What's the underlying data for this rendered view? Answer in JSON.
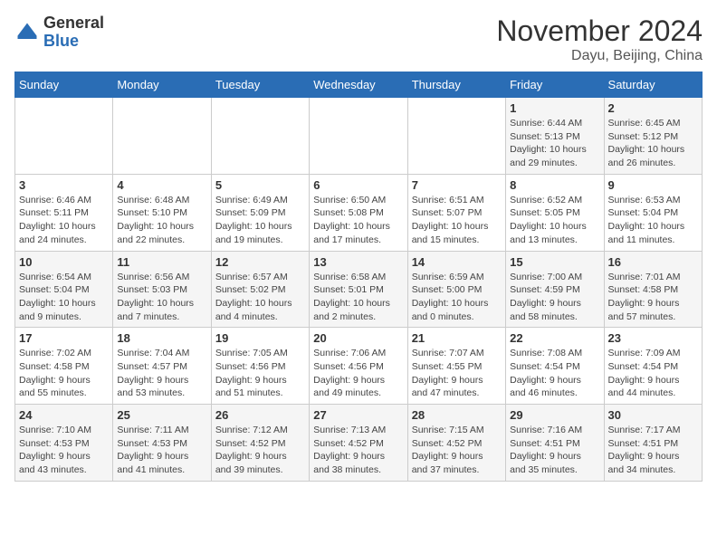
{
  "logo": {
    "general": "General",
    "blue": "Blue"
  },
  "header": {
    "month": "November 2024",
    "location": "Dayu, Beijing, China"
  },
  "weekdays": [
    "Sunday",
    "Monday",
    "Tuesday",
    "Wednesday",
    "Thursday",
    "Friday",
    "Saturday"
  ],
  "weeks": [
    [
      {
        "day": "",
        "info": ""
      },
      {
        "day": "",
        "info": ""
      },
      {
        "day": "",
        "info": ""
      },
      {
        "day": "",
        "info": ""
      },
      {
        "day": "",
        "info": ""
      },
      {
        "day": "1",
        "info": "Sunrise: 6:44 AM\nSunset: 5:13 PM\nDaylight: 10 hours\nand 29 minutes."
      },
      {
        "day": "2",
        "info": "Sunrise: 6:45 AM\nSunset: 5:12 PM\nDaylight: 10 hours\nand 26 minutes."
      }
    ],
    [
      {
        "day": "3",
        "info": "Sunrise: 6:46 AM\nSunset: 5:11 PM\nDaylight: 10 hours\nand 24 minutes."
      },
      {
        "day": "4",
        "info": "Sunrise: 6:48 AM\nSunset: 5:10 PM\nDaylight: 10 hours\nand 22 minutes."
      },
      {
        "day": "5",
        "info": "Sunrise: 6:49 AM\nSunset: 5:09 PM\nDaylight: 10 hours\nand 19 minutes."
      },
      {
        "day": "6",
        "info": "Sunrise: 6:50 AM\nSunset: 5:08 PM\nDaylight: 10 hours\nand 17 minutes."
      },
      {
        "day": "7",
        "info": "Sunrise: 6:51 AM\nSunset: 5:07 PM\nDaylight: 10 hours\nand 15 minutes."
      },
      {
        "day": "8",
        "info": "Sunrise: 6:52 AM\nSunset: 5:05 PM\nDaylight: 10 hours\nand 13 minutes."
      },
      {
        "day": "9",
        "info": "Sunrise: 6:53 AM\nSunset: 5:04 PM\nDaylight: 10 hours\nand 11 minutes."
      }
    ],
    [
      {
        "day": "10",
        "info": "Sunrise: 6:54 AM\nSunset: 5:04 PM\nDaylight: 10 hours\nand 9 minutes."
      },
      {
        "day": "11",
        "info": "Sunrise: 6:56 AM\nSunset: 5:03 PM\nDaylight: 10 hours\nand 7 minutes."
      },
      {
        "day": "12",
        "info": "Sunrise: 6:57 AM\nSunset: 5:02 PM\nDaylight: 10 hours\nand 4 minutes."
      },
      {
        "day": "13",
        "info": "Sunrise: 6:58 AM\nSunset: 5:01 PM\nDaylight: 10 hours\nand 2 minutes."
      },
      {
        "day": "14",
        "info": "Sunrise: 6:59 AM\nSunset: 5:00 PM\nDaylight: 10 hours\nand 0 minutes."
      },
      {
        "day": "15",
        "info": "Sunrise: 7:00 AM\nSunset: 4:59 PM\nDaylight: 9 hours\nand 58 minutes."
      },
      {
        "day": "16",
        "info": "Sunrise: 7:01 AM\nSunset: 4:58 PM\nDaylight: 9 hours\nand 57 minutes."
      }
    ],
    [
      {
        "day": "17",
        "info": "Sunrise: 7:02 AM\nSunset: 4:58 PM\nDaylight: 9 hours\nand 55 minutes."
      },
      {
        "day": "18",
        "info": "Sunrise: 7:04 AM\nSunset: 4:57 PM\nDaylight: 9 hours\nand 53 minutes."
      },
      {
        "day": "19",
        "info": "Sunrise: 7:05 AM\nSunset: 4:56 PM\nDaylight: 9 hours\nand 51 minutes."
      },
      {
        "day": "20",
        "info": "Sunrise: 7:06 AM\nSunset: 4:56 PM\nDaylight: 9 hours\nand 49 minutes."
      },
      {
        "day": "21",
        "info": "Sunrise: 7:07 AM\nSunset: 4:55 PM\nDaylight: 9 hours\nand 47 minutes."
      },
      {
        "day": "22",
        "info": "Sunrise: 7:08 AM\nSunset: 4:54 PM\nDaylight: 9 hours\nand 46 minutes."
      },
      {
        "day": "23",
        "info": "Sunrise: 7:09 AM\nSunset: 4:54 PM\nDaylight: 9 hours\nand 44 minutes."
      }
    ],
    [
      {
        "day": "24",
        "info": "Sunrise: 7:10 AM\nSunset: 4:53 PM\nDaylight: 9 hours\nand 43 minutes."
      },
      {
        "day": "25",
        "info": "Sunrise: 7:11 AM\nSunset: 4:53 PM\nDaylight: 9 hours\nand 41 minutes."
      },
      {
        "day": "26",
        "info": "Sunrise: 7:12 AM\nSunset: 4:52 PM\nDaylight: 9 hours\nand 39 minutes."
      },
      {
        "day": "27",
        "info": "Sunrise: 7:13 AM\nSunset: 4:52 PM\nDaylight: 9 hours\nand 38 minutes."
      },
      {
        "day": "28",
        "info": "Sunrise: 7:15 AM\nSunset: 4:52 PM\nDaylight: 9 hours\nand 37 minutes."
      },
      {
        "day": "29",
        "info": "Sunrise: 7:16 AM\nSunset: 4:51 PM\nDaylight: 9 hours\nand 35 minutes."
      },
      {
        "day": "30",
        "info": "Sunrise: 7:17 AM\nSunset: 4:51 PM\nDaylight: 9 hours\nand 34 minutes."
      }
    ]
  ]
}
